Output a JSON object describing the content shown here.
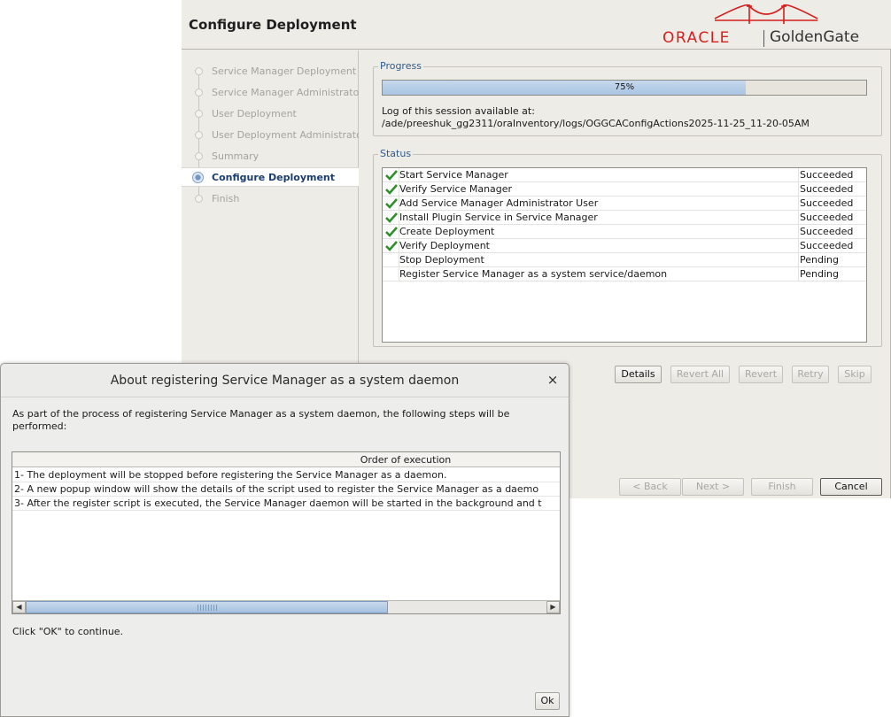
{
  "header": {
    "title": "Configure Deployment",
    "logo": {
      "oracle": "ORACLE",
      "product": "GoldenGate",
      "brand_color": "#d41f1f"
    }
  },
  "steps": [
    {
      "label": "Service Manager Deployment",
      "state": "done"
    },
    {
      "label": "Service Manager Administrator",
      "state": "done"
    },
    {
      "label": "User Deployment",
      "state": "done"
    },
    {
      "label": "User Deployment Administrator",
      "state": "done"
    },
    {
      "label": "Summary",
      "state": "done"
    },
    {
      "label": "Configure Deployment",
      "state": "active"
    },
    {
      "label": "Finish",
      "state": "pending"
    }
  ],
  "progress": {
    "group_title": "Progress",
    "percent": 75,
    "percent_text": "75%",
    "log_label": "Log of this session available at:",
    "log_path": "/ade/preeshuk_gg2311/oraInventory/logs/OGGCAConfigActions2025-11-25_11-20-05AM"
  },
  "status": {
    "group_title": "Status",
    "rows": [
      {
        "task": "Start Service Manager",
        "status": "Succeeded",
        "icon": "check-icon"
      },
      {
        "task": "Verify Service Manager",
        "status": "Succeeded",
        "icon": "check-icon"
      },
      {
        "task": "Add Service Manager Administrator User",
        "status": "Succeeded",
        "icon": "check-icon"
      },
      {
        "task": "Install Plugin Service in Service Manager",
        "status": "Succeeded",
        "icon": "check-icon"
      },
      {
        "task": "Create Deployment",
        "status": "Succeeded",
        "icon": "check-icon"
      },
      {
        "task": "Verify Deployment",
        "status": "Succeeded",
        "icon": "check-icon"
      },
      {
        "task": "Stop Deployment",
        "status": "Pending",
        "icon": ""
      },
      {
        "task": "Register Service Manager as a system service/daemon",
        "status": "Pending",
        "icon": ""
      }
    ]
  },
  "actions": {
    "details": "Details",
    "revert_all": "Revert All",
    "revert": "Revert",
    "retry": "Retry",
    "skip": "Skip"
  },
  "navigation": {
    "back": "< Back",
    "next": "Next >",
    "finish": "Finish",
    "cancel": "Cancel"
  },
  "dialog": {
    "title": "About registering Service Manager as a system daemon",
    "close": "×",
    "intro": "As part of the process of registering Service Manager as a system daemon, the following steps will be performed:",
    "table_header": "Order of execution",
    "rows": [
      "1- The deployment will be stopped before registering the Service Manager as a daemon.",
      "2- A new popup window will show the details of the script used to register the Service Manager as a daemo",
      "3- After the register script is executed, the Service Manager daemon will be started in the background and t"
    ],
    "scroll_left": "◀",
    "scroll_right": "▶",
    "footer": "Click \"OK\" to continue.",
    "ok": "Ok"
  }
}
